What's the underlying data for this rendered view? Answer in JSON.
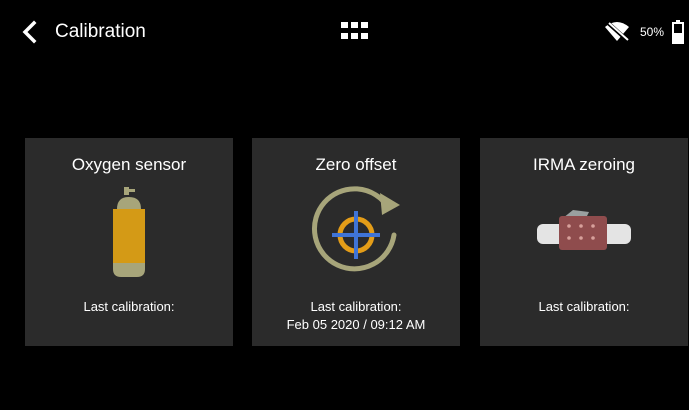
{
  "header": {
    "title": "Calibration",
    "back_icon": "chevron-left-icon",
    "apps_icon": "grid-icon",
    "wifi_icon": "wifi-off-icon",
    "battery_percent": "50%",
    "battery_level": 0.5
  },
  "cards": [
    {
      "title": "Oxygen sensor",
      "icon": "oxygen-cylinder-icon",
      "last_calibration_label": "Last calibration:",
      "last_calibration_value": ""
    },
    {
      "title": "Zero offset",
      "icon": "zero-offset-icon",
      "last_calibration_label": "Last calibration:",
      "last_calibration_value": "Feb 05 2020 / 09:12 AM"
    },
    {
      "title": "IRMA zeroing",
      "icon": "irma-sensor-icon",
      "last_calibration_label": "Last calibration:",
      "last_calibration_value": ""
    }
  ],
  "colors": {
    "background": "#000000",
    "card": "#2b2b2b",
    "cylinder_body": "#d49a16",
    "cylinder_cap": "#a7a57a",
    "ring": "#a7a57a",
    "crosshair_circle": "#e49d18",
    "crosshair_lines": "#3f74d7",
    "sensor_body": "#8f4c4d",
    "sensor_tube": "#e4e4e4"
  }
}
